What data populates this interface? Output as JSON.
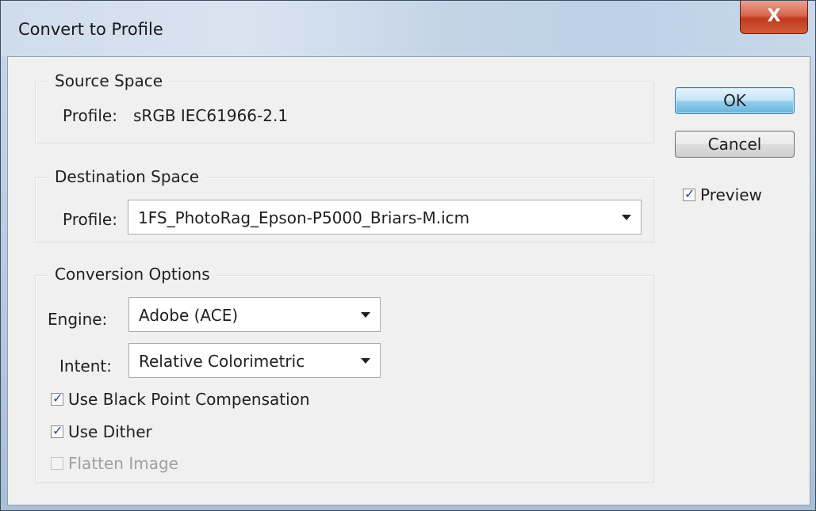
{
  "window": {
    "title": "Convert to Profile",
    "close_glyph": "X"
  },
  "source": {
    "group_title": "Source Space",
    "profile_label": "Profile:",
    "profile_value": "sRGB IEC61966-2.1"
  },
  "destination": {
    "group_title": "Destination Space",
    "profile_label": "Profile:",
    "profile_value": "1FS_PhotoRag_Epson-P5000_Briars-M.icm"
  },
  "conversion": {
    "group_title": "Conversion Options",
    "engine_label": "Engine:",
    "engine_value": "Adobe (ACE)",
    "intent_label": "Intent:",
    "intent_value": "Relative Colorimetric",
    "black_point": {
      "label": "Use Black Point Compensation",
      "checked": true
    },
    "dither": {
      "label": "Use Dither",
      "checked": true
    },
    "flatten": {
      "label": "Flatten Image",
      "checked": false,
      "enabled": false
    }
  },
  "buttons": {
    "ok": "OK",
    "cancel": "Cancel"
  },
  "preview": {
    "label": "Preview",
    "checked": true
  },
  "icons": {
    "check": "checkmark-icon",
    "dropdown": "chevron-down-icon",
    "close": "close-icon"
  }
}
